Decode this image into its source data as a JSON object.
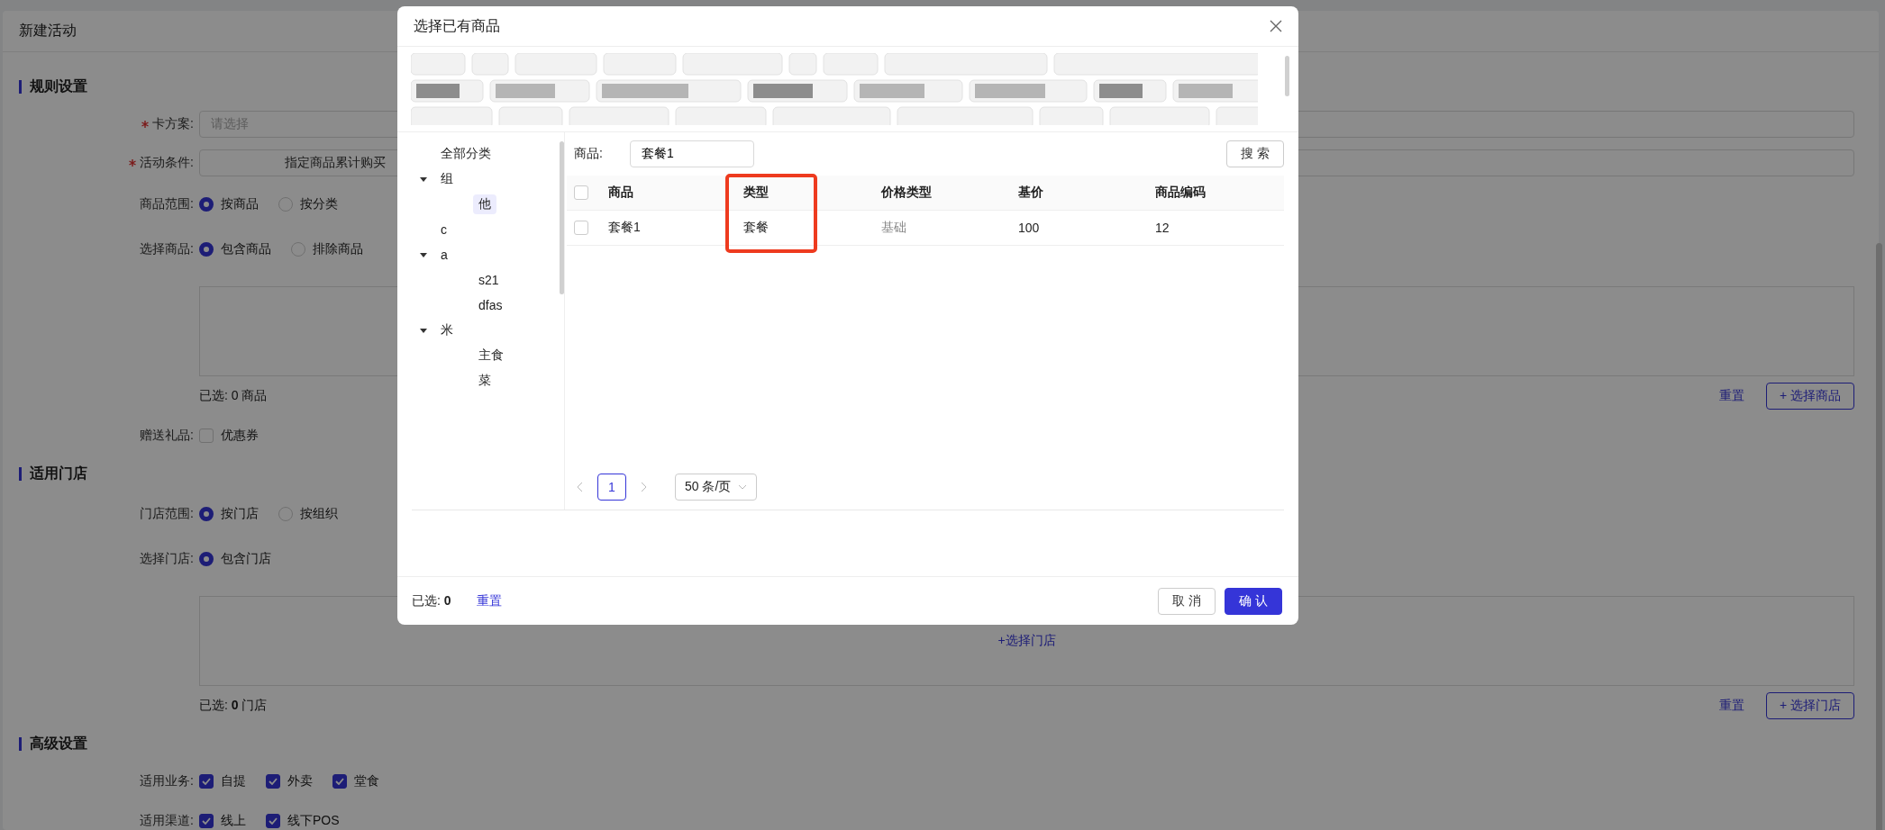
{
  "page": {
    "title": "新建活动"
  },
  "sections": [
    {
      "title": "规则设置",
      "rows": [
        {
          "kind": "select",
          "label": "卡方案:",
          "required": true,
          "placeholder": "请选择"
        },
        {
          "kind": "picker",
          "label": "活动条件:",
          "required": true,
          "value": "指定商品累计购买"
        },
        {
          "kind": "radio",
          "label": "商品范围:",
          "options": [
            {
              "label": "按商品",
              "selected": true
            },
            {
              "label": "按分类",
              "selected": false
            }
          ]
        },
        {
          "kind": "radio",
          "label": "选择商品:",
          "options": [
            {
              "label": "包含商品",
              "selected": true
            },
            {
              "label": "排除商品",
              "selected": false
            }
          ]
        },
        {
          "kind": "list_box",
          "summary": "已选: 0 商品",
          "reset": "重置",
          "add_button": "+ 选择商品"
        },
        {
          "kind": "checkbox",
          "label": "赠送礼品:",
          "options": [
            {
              "label": "优惠券",
              "checked": false
            }
          ]
        }
      ]
    },
    {
      "title": "适用门店",
      "rows": [
        {
          "kind": "radio",
          "label": "门店范围:",
          "options": [
            {
              "label": "按门店",
              "selected": true
            },
            {
              "label": "按组织",
              "selected": false
            }
          ]
        },
        {
          "kind": "radio",
          "label": "选择门店:",
          "options": [
            {
              "label": "包含门店",
              "selected": true
            }
          ]
        },
        {
          "kind": "list_box",
          "empty_link": "+选择门店",
          "summary": "已选: **0** 门店",
          "reset": "重置",
          "add_button": "+ 选择门店"
        }
      ]
    },
    {
      "title": "高级设置",
      "rows": [
        {
          "kind": "checkbox",
          "label": "适用业务:",
          "options": [
            {
              "label": "自提",
              "checked": true
            },
            {
              "label": "外卖",
              "checked": true
            },
            {
              "label": "堂食",
              "checked": true
            }
          ]
        },
        {
          "kind": "checkbox",
          "label": "适用渠道:",
          "options": [
            {
              "label": "线上",
              "checked": true
            },
            {
              "label": "线下POS",
              "checked": true
            }
          ]
        }
      ]
    }
  ],
  "dialog": {
    "title": "选择已有商品",
    "tree": [
      {
        "label": "全部分类",
        "selected": false
      },
      {
        "label": "组",
        "selected": false,
        "expanded": true,
        "children": [
          {
            "label": "他",
            "selected": true
          }
        ]
      },
      {
        "label": "c",
        "selected": false
      },
      {
        "label": "a",
        "selected": false,
        "expanded": true,
        "children": [
          {
            "label": "s21",
            "selected": false
          },
          {
            "label": "dfas",
            "selected": false
          }
        ]
      },
      {
        "label": "米",
        "selected": false,
        "expanded": true,
        "children": [
          {
            "label": "主食",
            "selected": false
          },
          {
            "label": "菜",
            "selected": false
          }
        ]
      }
    ],
    "search": {
      "label": "商品:",
      "value": "套餐1",
      "button": "搜 索"
    },
    "table": {
      "all_checked": false,
      "columns": [
        {
          "label": "商品",
          "highlighted": false
        },
        {
          "label": "类型",
          "highlighted": true
        },
        {
          "label": "价格类型",
          "highlighted": false
        },
        {
          "label": "基价",
          "highlighted": false
        },
        {
          "label": "商品编码",
          "highlighted": false
        }
      ],
      "rows": [
        {
          "checked": false,
          "cells": [
            "套餐1",
            "套餐",
            "基础",
            "100",
            "12"
          ]
        }
      ]
    },
    "pagination": {
      "pages": [
        {
          "label": "1",
          "selected": true
        }
      ],
      "page_size": "50 条/页"
    },
    "footer": {
      "selected_label": "已选: ",
      "selected_count": "0",
      "reset": "重置",
      "cancel": "取 消",
      "confirm": "确 认"
    }
  }
}
